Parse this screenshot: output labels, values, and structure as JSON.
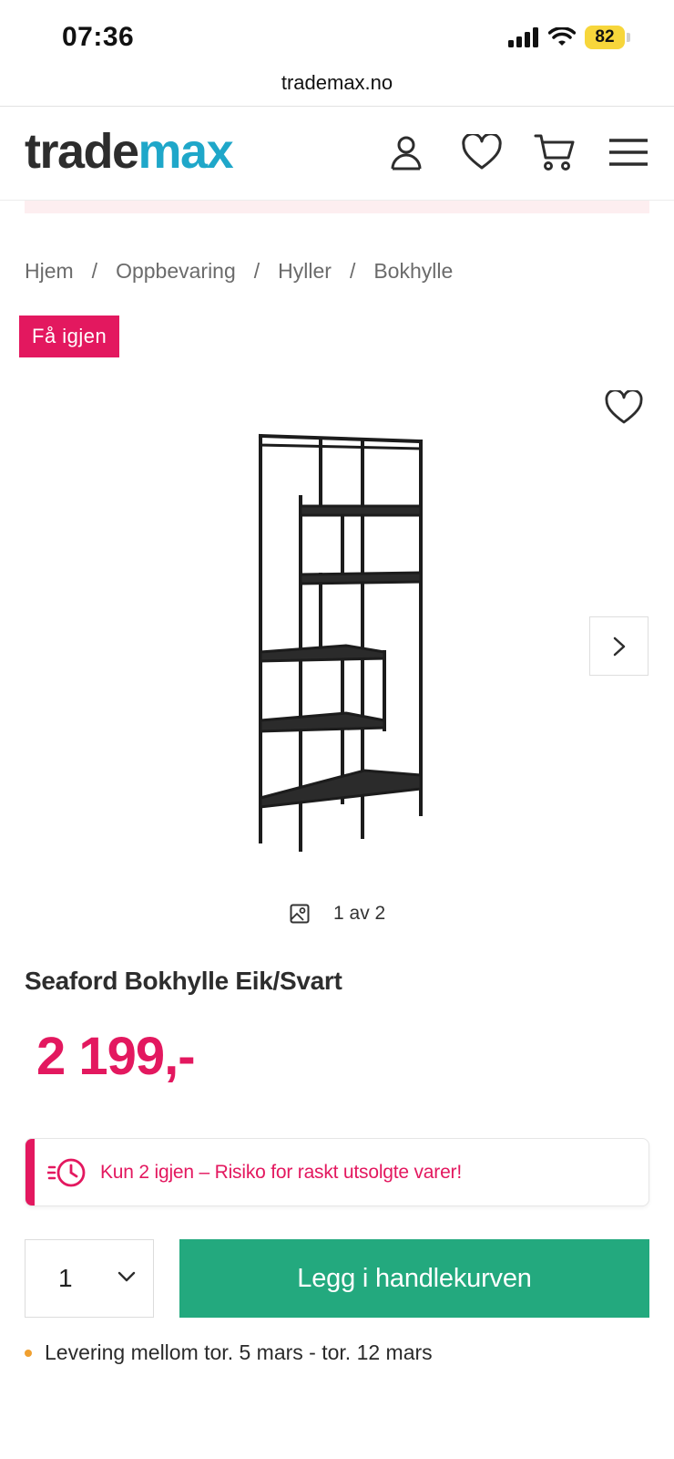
{
  "status_bar": {
    "time": "07:36",
    "battery": "82",
    "icons": [
      "signal-icon",
      "wifi-icon",
      "battery-icon"
    ]
  },
  "browser": {
    "url": "trademax.no"
  },
  "header": {
    "logo_part1": "trade",
    "logo_part2": "max",
    "icons": [
      "account-icon",
      "wishlist-icon",
      "cart-icon",
      "menu-icon"
    ]
  },
  "breadcrumb": {
    "items": [
      "Hjem",
      "Oppbevaring",
      "Hyller",
      "Bokhylle"
    ],
    "separator": "/"
  },
  "badge": "Få igjen",
  "gallery": {
    "counter": "1 av 2",
    "icons": [
      "favorite-icon",
      "chevron-right-icon",
      "image-icon"
    ]
  },
  "product": {
    "title": "Seaford Bokhylle Eik/Svart",
    "price": "2 199,-"
  },
  "stock_alert": {
    "message": "Kun 2 igjen – Risiko for raskt utsolgte varer!",
    "icon": "clock-icon"
  },
  "purchase": {
    "quantity": "1",
    "add_to_cart_label": "Legg i handlekurven"
  },
  "delivery": {
    "text": "Levering mellom tor. 5 mars - tor. 12 mars"
  },
  "colors": {
    "brand_pink": "#e3185f",
    "brand_cyan": "#1fa7c9",
    "cta_green": "#23a97e",
    "battery_yellow": "#f7d63b",
    "delivery_dot": "#f0a030"
  }
}
